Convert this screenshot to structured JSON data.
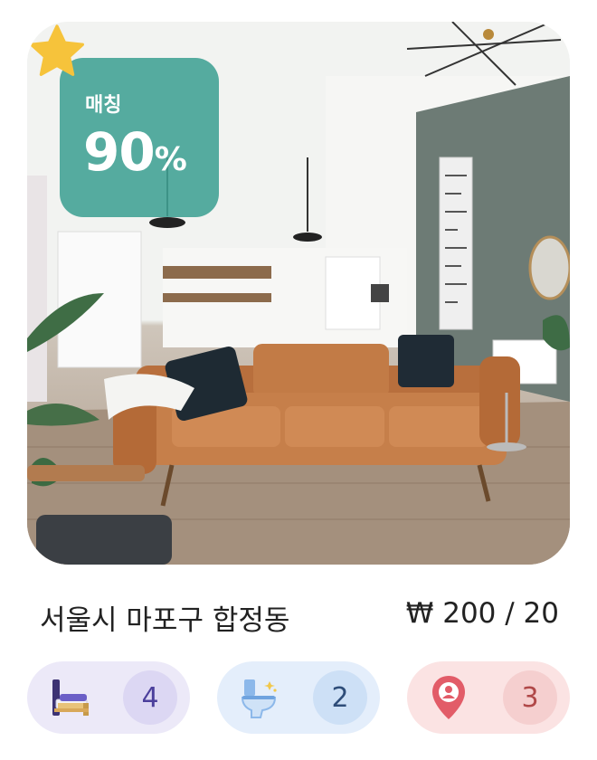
{
  "listing": {
    "match_label": "매칭",
    "match_value": "90",
    "match_unit": "%",
    "favorite_icon": "star-icon",
    "address": "서울시 마포구 합정동",
    "price": "₩ 200 / 20"
  },
  "features": [
    {
      "icon": "bed-icon",
      "count": "4"
    },
    {
      "icon": "toilet-icon",
      "count": "2"
    },
    {
      "icon": "location-pin-icon",
      "count": "3"
    }
  ],
  "colors": {
    "match_badge": "#3fa093",
    "star": "#f6c33b",
    "bed_pill": "#ece9f8",
    "bath_pill": "#e4eefb",
    "location_pill": "#fbe3e3"
  }
}
